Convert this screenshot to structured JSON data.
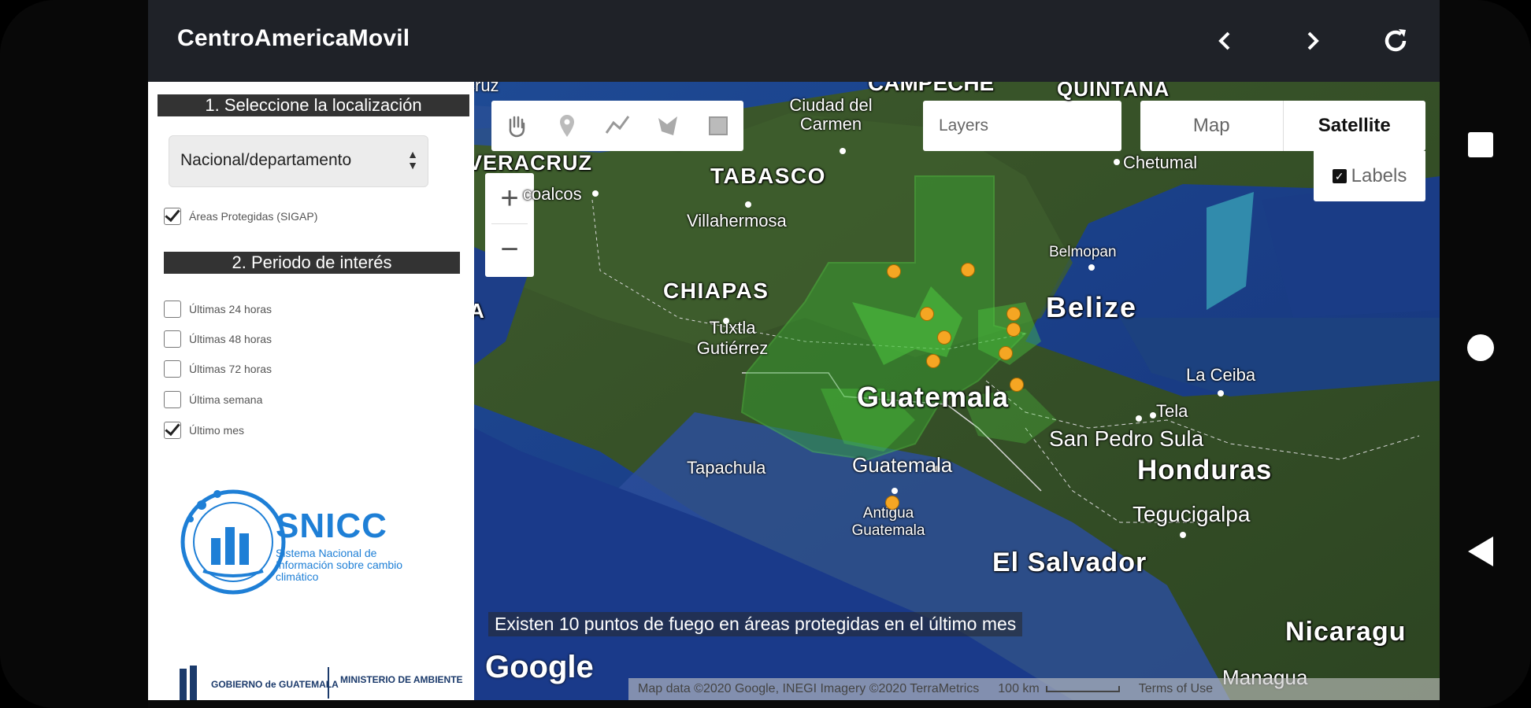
{
  "app": {
    "title": "CentroAmericaMovil",
    "back_icon": "chevron-left-icon",
    "forward_icon": "chevron-right-icon",
    "refresh_icon": "refresh-icon"
  },
  "sidebar": {
    "section1_title": "1. Seleccione la localización",
    "location_select_value": "Nacional/departamento",
    "protected_areas_label": "Áreas Protegidas (SIGAP)",
    "protected_areas_checked": true,
    "section2_title": "2. Periodo de interés",
    "periods": [
      {
        "label": "Últimas 24 horas",
        "checked": false
      },
      {
        "label": "Últimas 48 horas",
        "checked": false
      },
      {
        "label": "Últimas 72 horas",
        "checked": false
      },
      {
        "label": "Última semana",
        "checked": false
      },
      {
        "label": "Último mes",
        "checked": true
      }
    ],
    "logo_title": "SNICC",
    "logo_subtitle": "Sistema Nacional de Información sobre cambio climático",
    "footer_gov": "GOBIERNO de GUATEMALA",
    "footer_ministry": "MINISTERIO DE AMBIENTE"
  },
  "map": {
    "layers_placeholder": "Layers",
    "map_button": "Map",
    "satellite_button": "Satellite",
    "labels_checkbox": "Labels",
    "labels_checked": true,
    "zoom_in": "+",
    "zoom_out": "−",
    "places": {
      "campeche": "CAMPECHE",
      "quintana": "QUINTANA",
      "veracruz": "VERACRUZ",
      "tabasco": "TABASCO",
      "chiapas": "CHIAPAS",
      "belize": "Belize",
      "guatemala": "Guatemala",
      "honduras": "Honduras",
      "el_salvador": "El Salvador",
      "nicaragua": "Nicaragu",
      "a_edge": "A"
    },
    "cities": {
      "ciudad_del_carmen": "Ciudad del Carmen",
      "chetumal": "Chetumal",
      "coatzacoalcos": "coalcos",
      "villahermosa": "Villahermosa",
      "belmopan": "Belmopan",
      "tuxtla": "Tuxtla Gutiérrez",
      "la_ceiba": "La Ceiba",
      "tela": "Tela",
      "san_pedro_sula": "San Pedro Sula",
      "tapachula": "Tapachula",
      "guatemala_city": "Guatemala",
      "antigua": "Antigua Guatemala",
      "tegucigalpa": "Tegucigalpa",
      "managua": "Managua",
      "cruz": "cruz"
    },
    "fire_message": "Existen 10 puntos de fuego en áreas protegidas en el último mes",
    "google_logo": "Google",
    "attribution": "Map data ©2020 Google, INEGI Imagery ©2020 TerraMetrics",
    "scale": "100 km",
    "terms": "Terms of Use"
  },
  "system_nav": {
    "recents_icon": "square-icon",
    "home_icon": "circle-icon",
    "back_icon": "triangle-back-icon"
  }
}
